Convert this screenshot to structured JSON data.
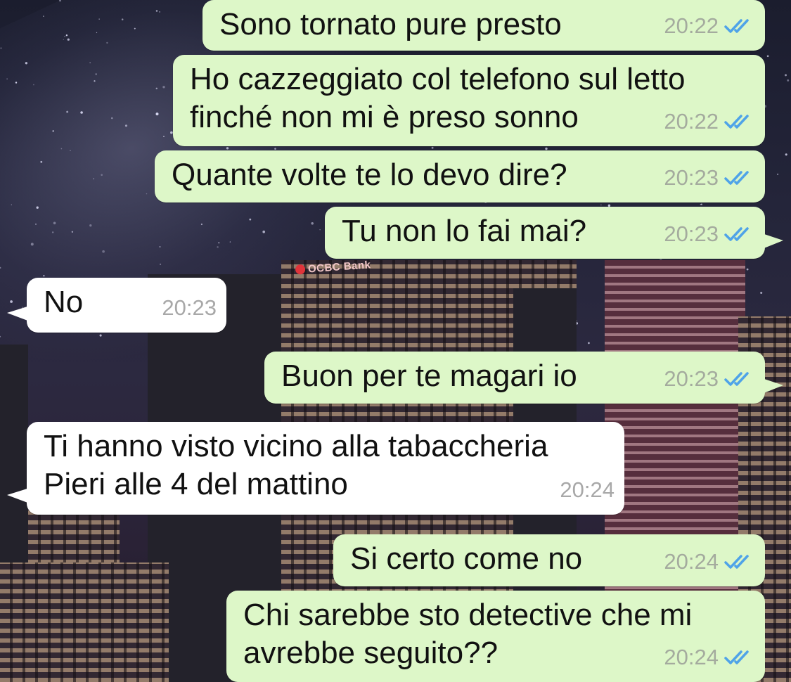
{
  "background": {
    "sign_text": "OCBC Bank"
  },
  "messages": [
    {
      "direction": "out",
      "text": "Sono tornato pure presto",
      "time": "20:22",
      "status": "read-double-check-icon"
    },
    {
      "direction": "out",
      "text": "Ho cazzeggiato col telefono sul letto\nfinché non mi è preso sonno",
      "time": "20:22",
      "status": "read-double-check-icon"
    },
    {
      "direction": "out",
      "text": "Quante volte te lo devo dire?",
      "time": "20:23",
      "status": "read-double-check-icon"
    },
    {
      "direction": "out",
      "text": "Tu non lo fai mai?",
      "time": "20:23",
      "status": "read-double-check-icon"
    },
    {
      "direction": "in",
      "text": "No",
      "time": "20:23"
    },
    {
      "direction": "out",
      "text": "Buon per te magari io",
      "time": "20:23",
      "status": "read-double-check-icon"
    },
    {
      "direction": "in",
      "text": "Ti hanno visto vicino alla tabaccheria\nPieri alle 4 del mattino",
      "time": "20:24"
    },
    {
      "direction": "out",
      "text": "Si certo come no",
      "time": "20:24",
      "status": "read-double-check-icon"
    },
    {
      "direction": "out",
      "text": "Chi sarebbe sto detective che mi\navrebbe seguito??",
      "time": "20:24",
      "status": "read-double-check-icon"
    }
  ],
  "colors": {
    "outgoing_bubble": "#ddf7c8",
    "incoming_bubble": "#ffffff",
    "read_ticks": "#4fa3e8",
    "timestamp": "#a4ab9e"
  }
}
